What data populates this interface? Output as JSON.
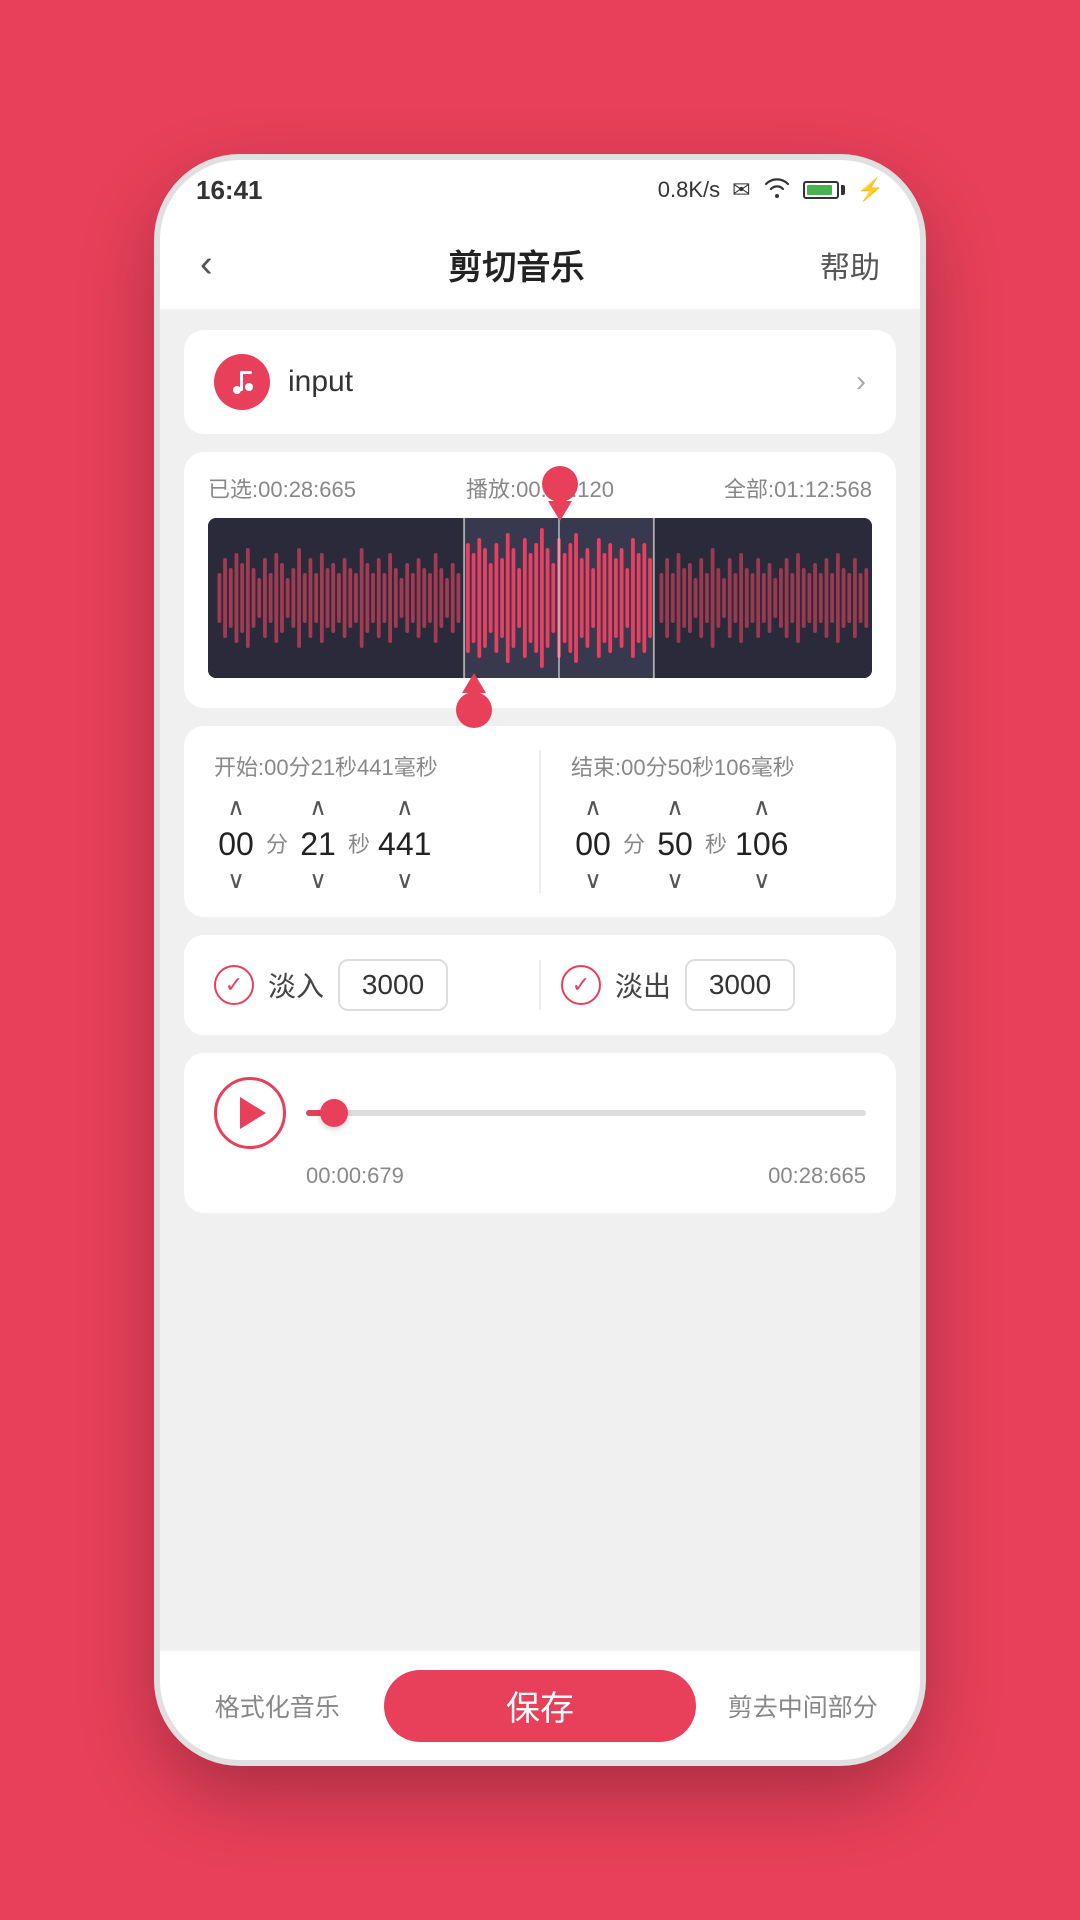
{
  "status_bar": {
    "time": "16:41",
    "network_speed": "0.8K/s",
    "battery_level": "100"
  },
  "top_bar": {
    "back_label": "‹",
    "title": "剪切音乐",
    "help_label": "帮助"
  },
  "file_row": {
    "filename": "input",
    "chevron": "›"
  },
  "waveform": {
    "selected_time": "已选:00:28:665",
    "playback_time": "播放:00:22:120",
    "total_time": "全部:01:12:568"
  },
  "time_adjust": {
    "start_label": "开始:00分21秒441毫秒",
    "end_label": "结束:00分50秒106毫秒",
    "start": {
      "minutes": "00",
      "seconds": "21",
      "milliseconds": "441"
    },
    "end": {
      "minutes": "00",
      "seconds": "50",
      "milliseconds": "106"
    },
    "unit_min": "分",
    "unit_sec": "秒"
  },
  "fade": {
    "fade_in_label": "淡入",
    "fade_in_value": "3000",
    "fade_out_label": "淡出",
    "fade_out_value": "3000"
  },
  "player": {
    "current_time": "00:00:679",
    "end_time": "00:28:665"
  },
  "bottom_bar": {
    "format_label": "格式化音乐",
    "save_label": "保存",
    "trim_label": "剪去中间部分"
  }
}
